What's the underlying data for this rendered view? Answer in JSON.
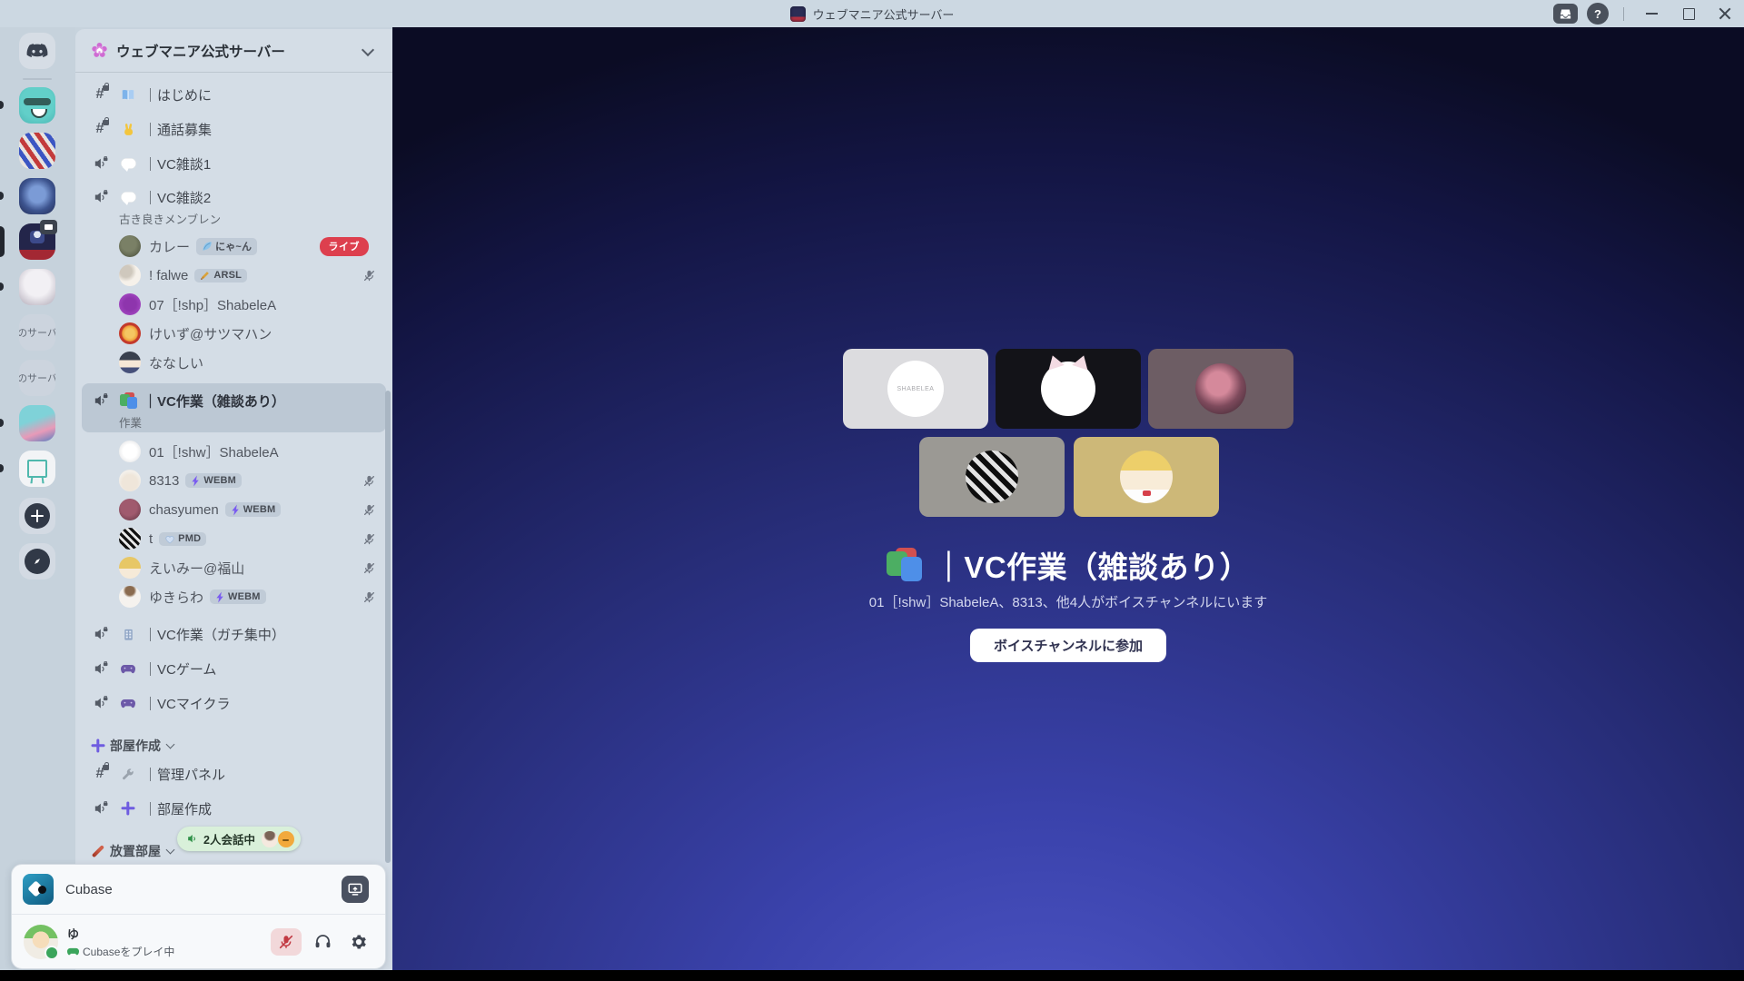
{
  "titlebar": {
    "title": "ウェブマニア公式サーバー"
  },
  "rail": {
    "text_server_1": "のサーバ",
    "text_server_2": "のサーバ"
  },
  "sidebar": {
    "server_name": "ウェブマニア公式サーバー",
    "channels": {
      "hajimeni": "｜はじめに",
      "tsuwabosyu": "｜通話募集",
      "vc_zatsudan1": "｜VC雑談1",
      "vc_zatsudan2": "｜VC雑談2",
      "vc_zatsudan2_status": "古き良きメンブレン",
      "vc_sagyo_zatsudan": "｜VC作業（雑談あり）",
      "vc_sagyo_zatsudan_status": "作業",
      "vc_sagyo_gachi": "｜VC作業（ガチ集中）",
      "vc_game": "｜VCゲーム",
      "vc_minecraft": "｜VCマイクラ",
      "kanri_panel": "｜管理パネル",
      "heya_sakusei_channel": "｜部屋作成",
      "heya_sakusei_category": "部屋作成",
      "houchi_category": "放置部屋"
    },
    "members": {
      "curry": {
        "name": "カレー",
        "badge": "にゃ~ん",
        "live_badge": "ライブ"
      },
      "falwe": {
        "name": "! falwe",
        "badge": "ARSL"
      },
      "shabele07": {
        "name": "07［!shp］ShabeleA"
      },
      "keizu": {
        "name": "けいず@サツマハン"
      },
      "nanashii": {
        "name": "ななしい"
      },
      "shabele01": {
        "name": "01［!shw］ShabeleA"
      },
      "m8313": {
        "name": "8313",
        "badge": "WEBM"
      },
      "chasyumen": {
        "name": "chasyumen",
        "badge": "WEBM"
      },
      "t": {
        "name": "t",
        "badge": "PMD"
      },
      "eimy": {
        "name": "えいみー@福山"
      },
      "yukirawa": {
        "name": "ゆきらわ",
        "badge": "WEBM"
      }
    },
    "call_pill": "2人会話中"
  },
  "user_panel": {
    "activity": "Cubase",
    "username": "ゆ",
    "status": "Cubaseをプレイ中"
  },
  "main": {
    "channel_title": "｜VC作業（雑談あり）",
    "participants_line": "01［!shw］ShabeleA、8313、他4人がボイスチャンネルにいます",
    "join_button": "ボイスチャンネルに参加",
    "tile_logo": "SHABELEA"
  },
  "colors": {
    "live_badge": "#dd3f4e",
    "online_green": "#3ba55c",
    "accent_purple": "#6e5ce0",
    "main_gradient_bright": "#4f57c8",
    "main_gradient_dark": "#0b0c24"
  }
}
